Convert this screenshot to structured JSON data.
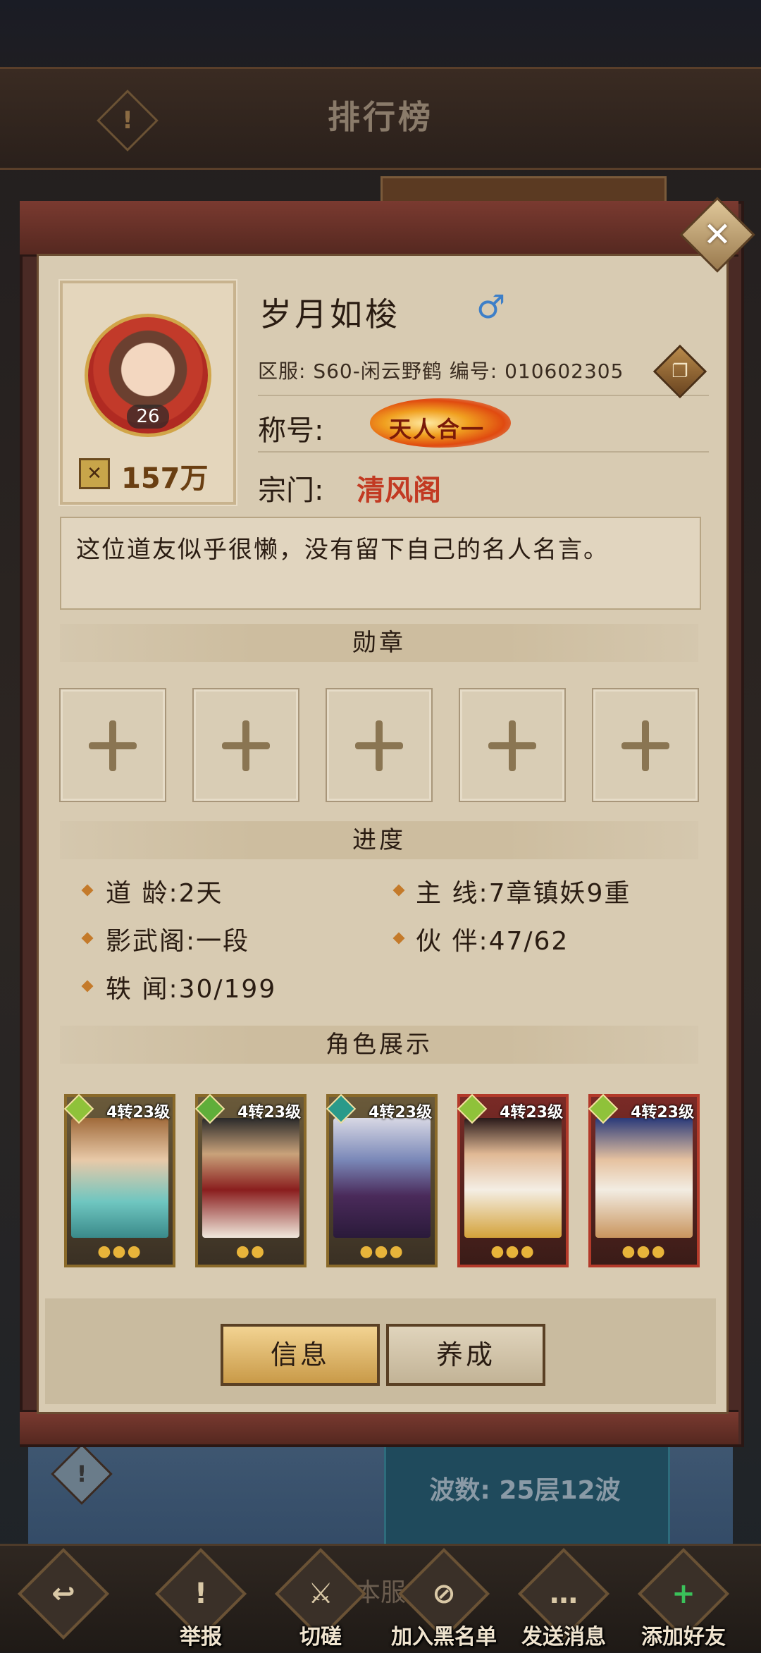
{
  "background": {
    "title": "排行榜",
    "alert_glyph": "!",
    "wave_text": "波数: 25层12波",
    "server_hint": "本服"
  },
  "profile": {
    "name": "岁月如梭",
    "gender_symbol": "♂",
    "level": "26",
    "power": "157万",
    "server_line": "区服: S60-闲云野鹤 编号: 010602305",
    "title_label": "称号:",
    "title_badge": "天人合一",
    "sect_label": "宗门:",
    "sect_value": "清风阁",
    "motto": "这位道友似乎很懒，没有留下自己的名人名言。"
  },
  "sections": {
    "medals": "勋章",
    "progress": "进度",
    "showcase": "角色展示"
  },
  "medal_slots": [
    "+",
    "+",
    "+",
    "+",
    "+"
  ],
  "progress": [
    {
      "text": "道  龄:2天"
    },
    {
      "text": "主  线:7章镇妖9重"
    },
    {
      "text": "影武阁:一段"
    },
    {
      "text": "伙  伴:47/62"
    },
    {
      "text": "轶  闻:30/199"
    }
  ],
  "heroes": [
    {
      "tag": "4转23级",
      "stars": "●●●",
      "gem_color": "#8fc23a"
    },
    {
      "tag": "4转23级",
      "stars": "●●",
      "gem_color": "#5fae3a"
    },
    {
      "tag": "4转23级",
      "stars": "●●●",
      "gem_color": "#2a9a8a"
    },
    {
      "tag": "4转23级",
      "stars": "●●●",
      "gem_color": "#8fc23a"
    },
    {
      "tag": "4转23级",
      "stars": "●●●",
      "gem_color": "#8fc23a"
    }
  ],
  "buttons": {
    "info": "信息",
    "train": "养成",
    "close": "✕"
  },
  "bottom_bar": [
    {
      "label": "",
      "glyph": "↩"
    },
    {
      "label": "举报",
      "glyph": "!"
    },
    {
      "label": "切磋",
      "glyph": "⚔"
    },
    {
      "label": "加入黑名单",
      "glyph": "⊘"
    },
    {
      "label": "发送消息",
      "glyph": "…"
    },
    {
      "label": "添加好友",
      "glyph": "+"
    }
  ],
  "colors": {
    "sect": "#c23a22",
    "gender": "#3d7fc8",
    "power": "#6a3f12"
  }
}
